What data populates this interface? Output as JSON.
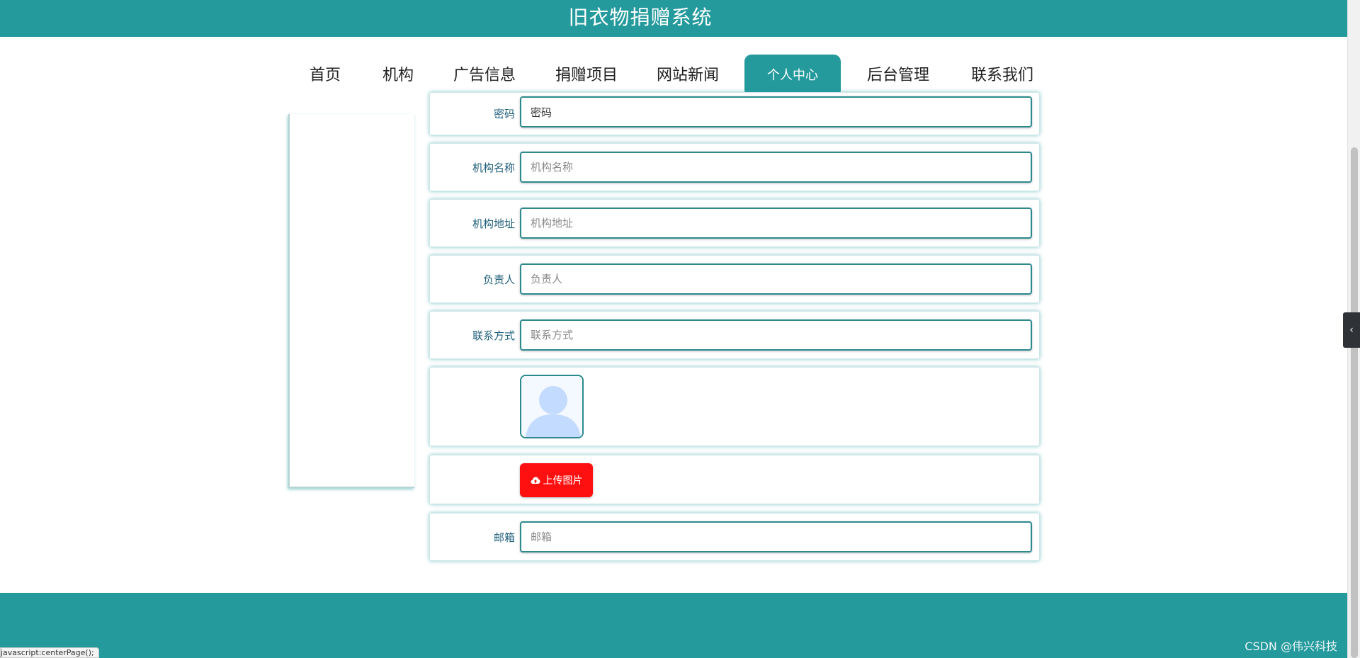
{
  "header": {
    "title": "旧衣物捐赠系统"
  },
  "nav": {
    "items": [
      {
        "label": "首页"
      },
      {
        "label": "机构"
      },
      {
        "label": "广告信息"
      },
      {
        "label": "捐赠项目"
      },
      {
        "label": "网站新闻"
      },
      {
        "label": "个人中心",
        "active": true
      },
      {
        "label": "后台管理"
      },
      {
        "label": "联系我们"
      }
    ]
  },
  "form": {
    "top_partial": {
      "label": "密码",
      "value": "密码"
    },
    "fields": [
      {
        "label": "机构名称",
        "placeholder": "机构名称"
      },
      {
        "label": "机构地址",
        "placeholder": "机构地址"
      },
      {
        "label": "负责人",
        "placeholder": "负责人"
      },
      {
        "label": "联系方式",
        "placeholder": "联系方式"
      }
    ],
    "upload_label": "上传图片",
    "email": {
      "label": "邮箱",
      "placeholder": "邮箱"
    }
  },
  "footer": {
    "watermark": "CSDN @伟兴科技"
  },
  "statusbar": {
    "text": "javascript:centerPage();"
  },
  "colors": {
    "primary": "#259a9d",
    "upload_button": "#ff1010",
    "label": "#1f5f7a"
  },
  "icons": {
    "upload": "cloud-upload-icon",
    "avatar": "user-avatar-placeholder",
    "side_toggle": "chevron-left-icon"
  }
}
